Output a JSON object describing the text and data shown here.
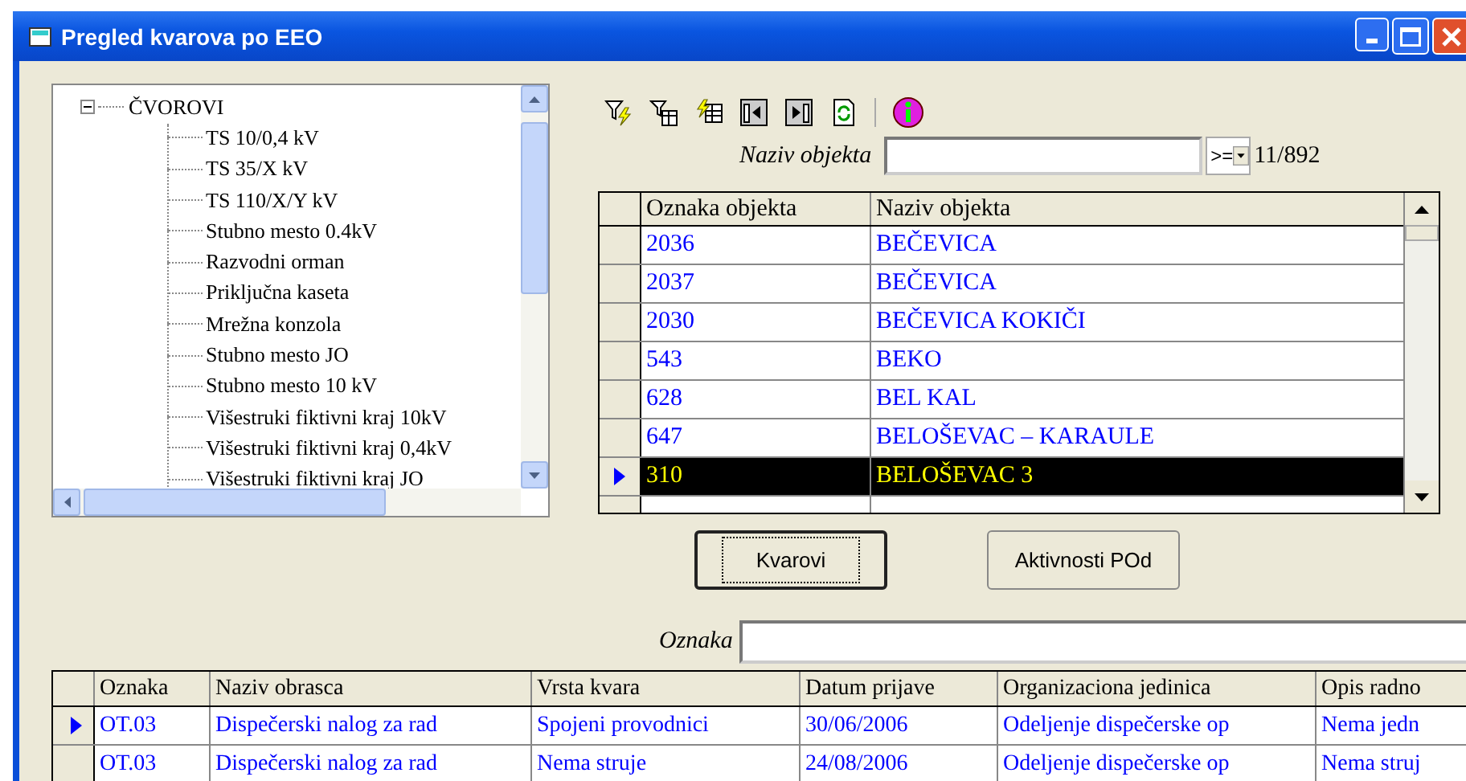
{
  "window": {
    "title": "Pregled kvarova po EEO"
  },
  "tree": {
    "label": "ČVOROVI",
    "expanded": true,
    "children": [
      {
        "label": "TS 10/0,4 kV"
      },
      {
        "label": "TS 35/X kV"
      },
      {
        "label": "TS 110/X/Y kV"
      },
      {
        "label": "Stubno mesto 0.4kV"
      },
      {
        "label": "Razvodni orman"
      },
      {
        "label": "Priključna kaseta"
      },
      {
        "label": "Mrežna konzola"
      },
      {
        "label": "Stubno mesto JO"
      },
      {
        "label": "Stubno mesto 10 kV"
      },
      {
        "label": "Višestruki fiktivni kraj 10kV"
      },
      {
        "label": "Višestruki fiktivni kraj 0,4kV"
      },
      {
        "label": "Višestruki fiktivni kraj JO"
      }
    ]
  },
  "search": {
    "label": "Naziv objekta",
    "operator": ">=",
    "count": "11/892"
  },
  "objects_table": {
    "columns": [
      "Oznaka objekta",
      "Naziv objekta"
    ],
    "rows": [
      {
        "cells": [
          "2036",
          "BEČEVICA"
        ],
        "selected": false
      },
      {
        "cells": [
          "2037",
          "BEČEVICA"
        ],
        "selected": false
      },
      {
        "cells": [
          "2030",
          "BEČEVICA KOKIČI"
        ],
        "selected": false
      },
      {
        "cells": [
          "543",
          "BEKO"
        ],
        "selected": false
      },
      {
        "cells": [
          "628",
          "BEL KAL"
        ],
        "selected": false
      },
      {
        "cells": [
          "647",
          "BELOŠEVAC – KARAULE"
        ],
        "selected": false
      },
      {
        "cells": [
          "310",
          "BELOŠEVAC 3"
        ],
        "selected": true
      }
    ]
  },
  "buttons": [
    {
      "label": "Kvarovi",
      "focused": true
    },
    {
      "label": "Aktivnosti POd",
      "focused": false
    }
  ],
  "oznaka_filter": {
    "label": "Oznaka"
  },
  "faults_table": {
    "columns": [
      "Oznaka",
      "Naziv obrasca",
      "Vrsta kvara",
      "Datum prijave",
      "Organizaciona jedinica",
      "Opis radno"
    ],
    "rows": [
      {
        "cells": [
          "OT.03",
          "Dispečerski nalog za rad",
          "Spojeni provodnici",
          "30/06/2006",
          "Odeljenje dispečerske op",
          "Nema jedn"
        ],
        "selected": true
      },
      {
        "cells": [
          "OT.03",
          "Dispečerski nalog za rad",
          "Nema struje",
          "24/08/2006",
          "Odeljenje dispečerske op",
          "Nema struj"
        ],
        "selected": false
      }
    ]
  }
}
